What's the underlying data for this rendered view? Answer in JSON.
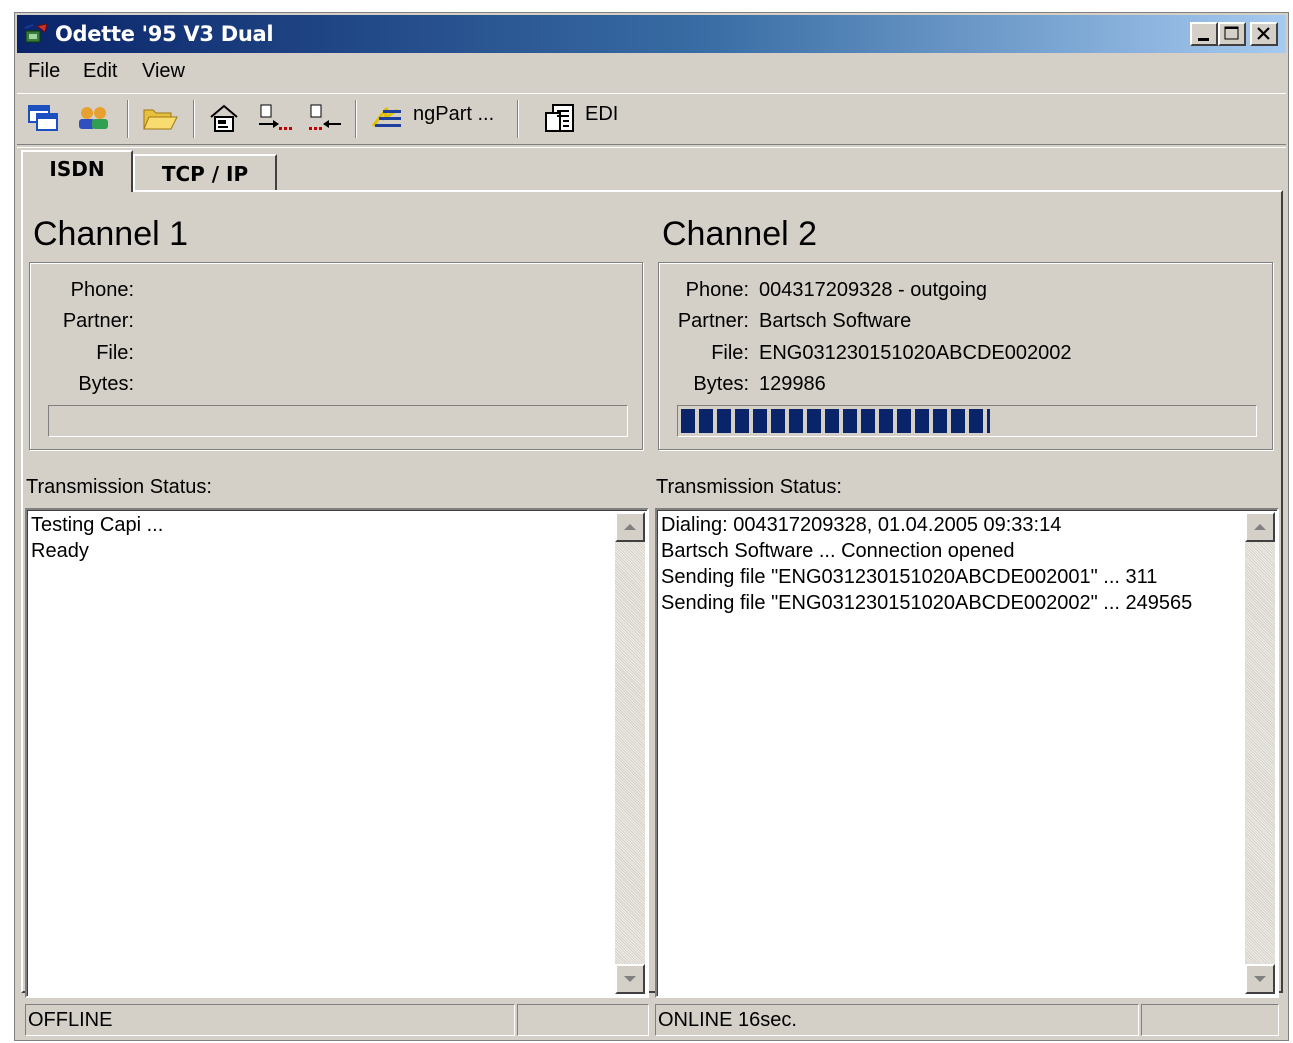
{
  "window": {
    "title": "Odette '95 V3 Dual",
    "controls": {
      "minimize": "minimize",
      "maximize": "maximize",
      "close": "close"
    }
  },
  "menu": {
    "items": [
      "File",
      "Edit",
      "View"
    ]
  },
  "toolbar": {
    "buttons": [
      {
        "icon": "windows-icon"
      },
      {
        "icon": "users-icon"
      },
      {
        "icon": "folder-open-icon"
      },
      {
        "icon": "home-icon"
      },
      {
        "icon": "send-icon"
      },
      {
        "icon": "receive-icon"
      },
      {
        "icon": "partner-icon",
        "label": "ngPart ..."
      },
      {
        "icon": "document-icon",
        "label": "EDI"
      }
    ]
  },
  "tabs": {
    "items": [
      "ISDN",
      "TCP / IP"
    ],
    "active": "ISDN"
  },
  "labels": {
    "phone": "Phone:",
    "partner": "Partner:",
    "file": "File:",
    "bytes": "Bytes:",
    "transmission_status": "Transmission Status:"
  },
  "channel1": {
    "title": "Channel 1",
    "phone": "",
    "partner": "",
    "file": "",
    "bytes": "",
    "progress": 0,
    "log": [
      "Testing Capi ...",
      "Ready"
    ],
    "status": "OFFLINE",
    "status_extra": ""
  },
  "channel2": {
    "title": "Channel 2",
    "phone": "004317209328 - outgoing",
    "partner": "Bartsch Software",
    "file": "ENG031230151020ABCDE002002",
    "bytes": "129986",
    "progress": 0.54,
    "log": [
      "Dialing: 004317209328, 01.04.2005 09:33:14",
      "Bartsch Software ... Connection opened",
      "Sending file \"ENG031230151020ABCDE002001\" ... 311",
      "Sending file \"ENG031230151020ABCDE002002\" ... 249565"
    ],
    "status": "ONLINE 16sec.",
    "status_extra": ""
  },
  "colors": {
    "progress": "#0a246a",
    "title_start": "#0a246a",
    "title_end": "#a6caf0",
    "face": "#d4d0c8"
  }
}
